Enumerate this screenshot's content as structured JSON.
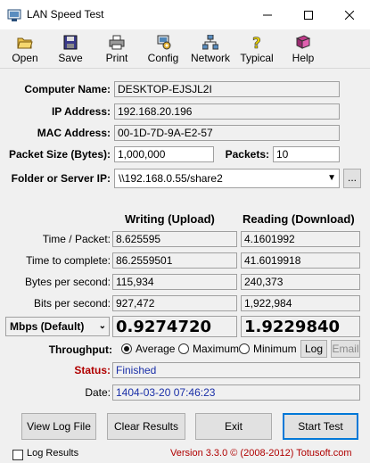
{
  "window": {
    "title": "LAN Speed Test"
  },
  "toolbar": [
    {
      "name": "open",
      "label": "Open",
      "icon": "folder-open-icon"
    },
    {
      "name": "save",
      "label": "Save",
      "icon": "floppy-icon"
    },
    {
      "name": "print",
      "label": "Print",
      "icon": "printer-icon"
    },
    {
      "name": "config",
      "label": "Config",
      "icon": "config-icon"
    },
    {
      "name": "network",
      "label": "Network",
      "icon": "network-icon"
    },
    {
      "name": "typical",
      "label": "Typical",
      "icon": "question-icon"
    },
    {
      "name": "help",
      "label": "Help",
      "icon": "book-icon"
    }
  ],
  "info": {
    "computer_name_label": "Computer Name:",
    "computer_name": "DESKTOP-EJSJL2I",
    "ip_label": "IP Address:",
    "ip": "192.168.20.196",
    "mac_label": "MAC Address:",
    "mac": "00-1D-7D-9A-E2-57",
    "packet_size_label": "Packet Size (Bytes):",
    "packet_size": "1,000,000",
    "packets_label": "Packets:",
    "packets": "10",
    "folder_label": "Folder or Server IP:",
    "folder": "\\\\192.168.0.55/share2",
    "browse": "..."
  },
  "results": {
    "writing_header": "Writing (Upload)",
    "reading_header": "Reading (Download)",
    "rows": [
      {
        "label": "Time / Packet:",
        "write": "8.625595",
        "read": "4.1601992"
      },
      {
        "label": "Time to complete:",
        "write": "86.2559501",
        "read": "41.6019918"
      },
      {
        "label": "Bytes per second:",
        "write": "115,934",
        "read": "240,373"
      },
      {
        "label": "Bits per second:",
        "write": "927,472",
        "read": "1,922,984"
      }
    ],
    "unit": "Mbps (Default)",
    "write_mbps": "0.9274720",
    "read_mbps": "1.9229840"
  },
  "throughput": {
    "label": "Throughput:",
    "options": [
      "Average",
      "Maximum",
      "Minimum"
    ],
    "selected": "Average",
    "log": "Log",
    "email": "Email"
  },
  "status": {
    "label": "Status:",
    "value": "Finished",
    "date_label": "Date:",
    "date": "1404-03-20 07:46:23",
    "label_color": "#b00000",
    "value_color": "#1a2fa8"
  },
  "buttons": {
    "view_log": "View Log File",
    "clear": "Clear Results",
    "exit": "Exit",
    "start": "Start Test"
  },
  "footer": {
    "log_results": "Log Results",
    "version": "Version 3.3.0  © (2008-2012) Totusoft.com"
  }
}
